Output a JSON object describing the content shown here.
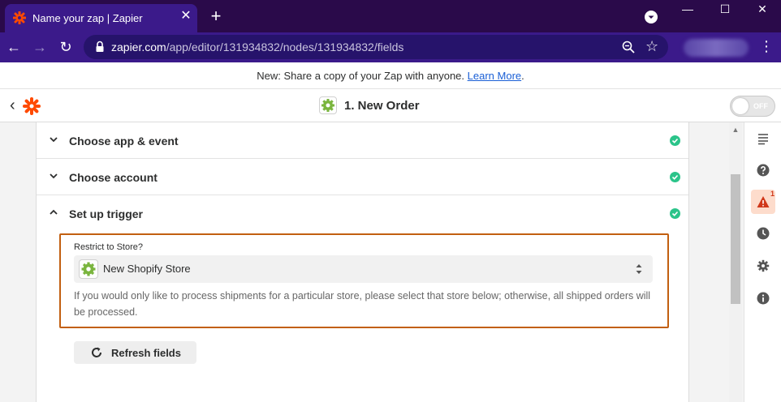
{
  "browser": {
    "tab_title": "Name your zap | Zapier",
    "tab_close": "✕",
    "new_tab": "+",
    "url_host": "zapier.com",
    "url_path": "/app/editor/131934832/nodes/131934832/fields",
    "window_min": "—",
    "window_max": "☐",
    "window_close": "✕"
  },
  "announcement": {
    "text": "New: Share a copy of your Zap with anyone.",
    "link": "Learn More",
    "suffix": "."
  },
  "editor": {
    "step_title": "1. New Order",
    "toggle_label": "OFF"
  },
  "sections": [
    {
      "title": "Choose app & event",
      "expanded": false,
      "complete": true
    },
    {
      "title": "Choose account",
      "expanded": false,
      "complete": true
    },
    {
      "title": "Set up trigger",
      "expanded": true,
      "complete": true
    }
  ],
  "field": {
    "label": "Restrict to Store?",
    "value": "New Shopify Store",
    "help": "If you would only like to process shipments for a particular store, please select that store below; otherwise, all shipped orders will be processed."
  },
  "refresh_button": {
    "label": "Refresh fields"
  },
  "rail": {
    "alert_count": "1"
  },
  "colors": {
    "brand_orange": "#ff4a00",
    "browser_purple": "#3b1a8a",
    "success_green": "#2bc48a",
    "highlight_border": "#c25f10"
  }
}
